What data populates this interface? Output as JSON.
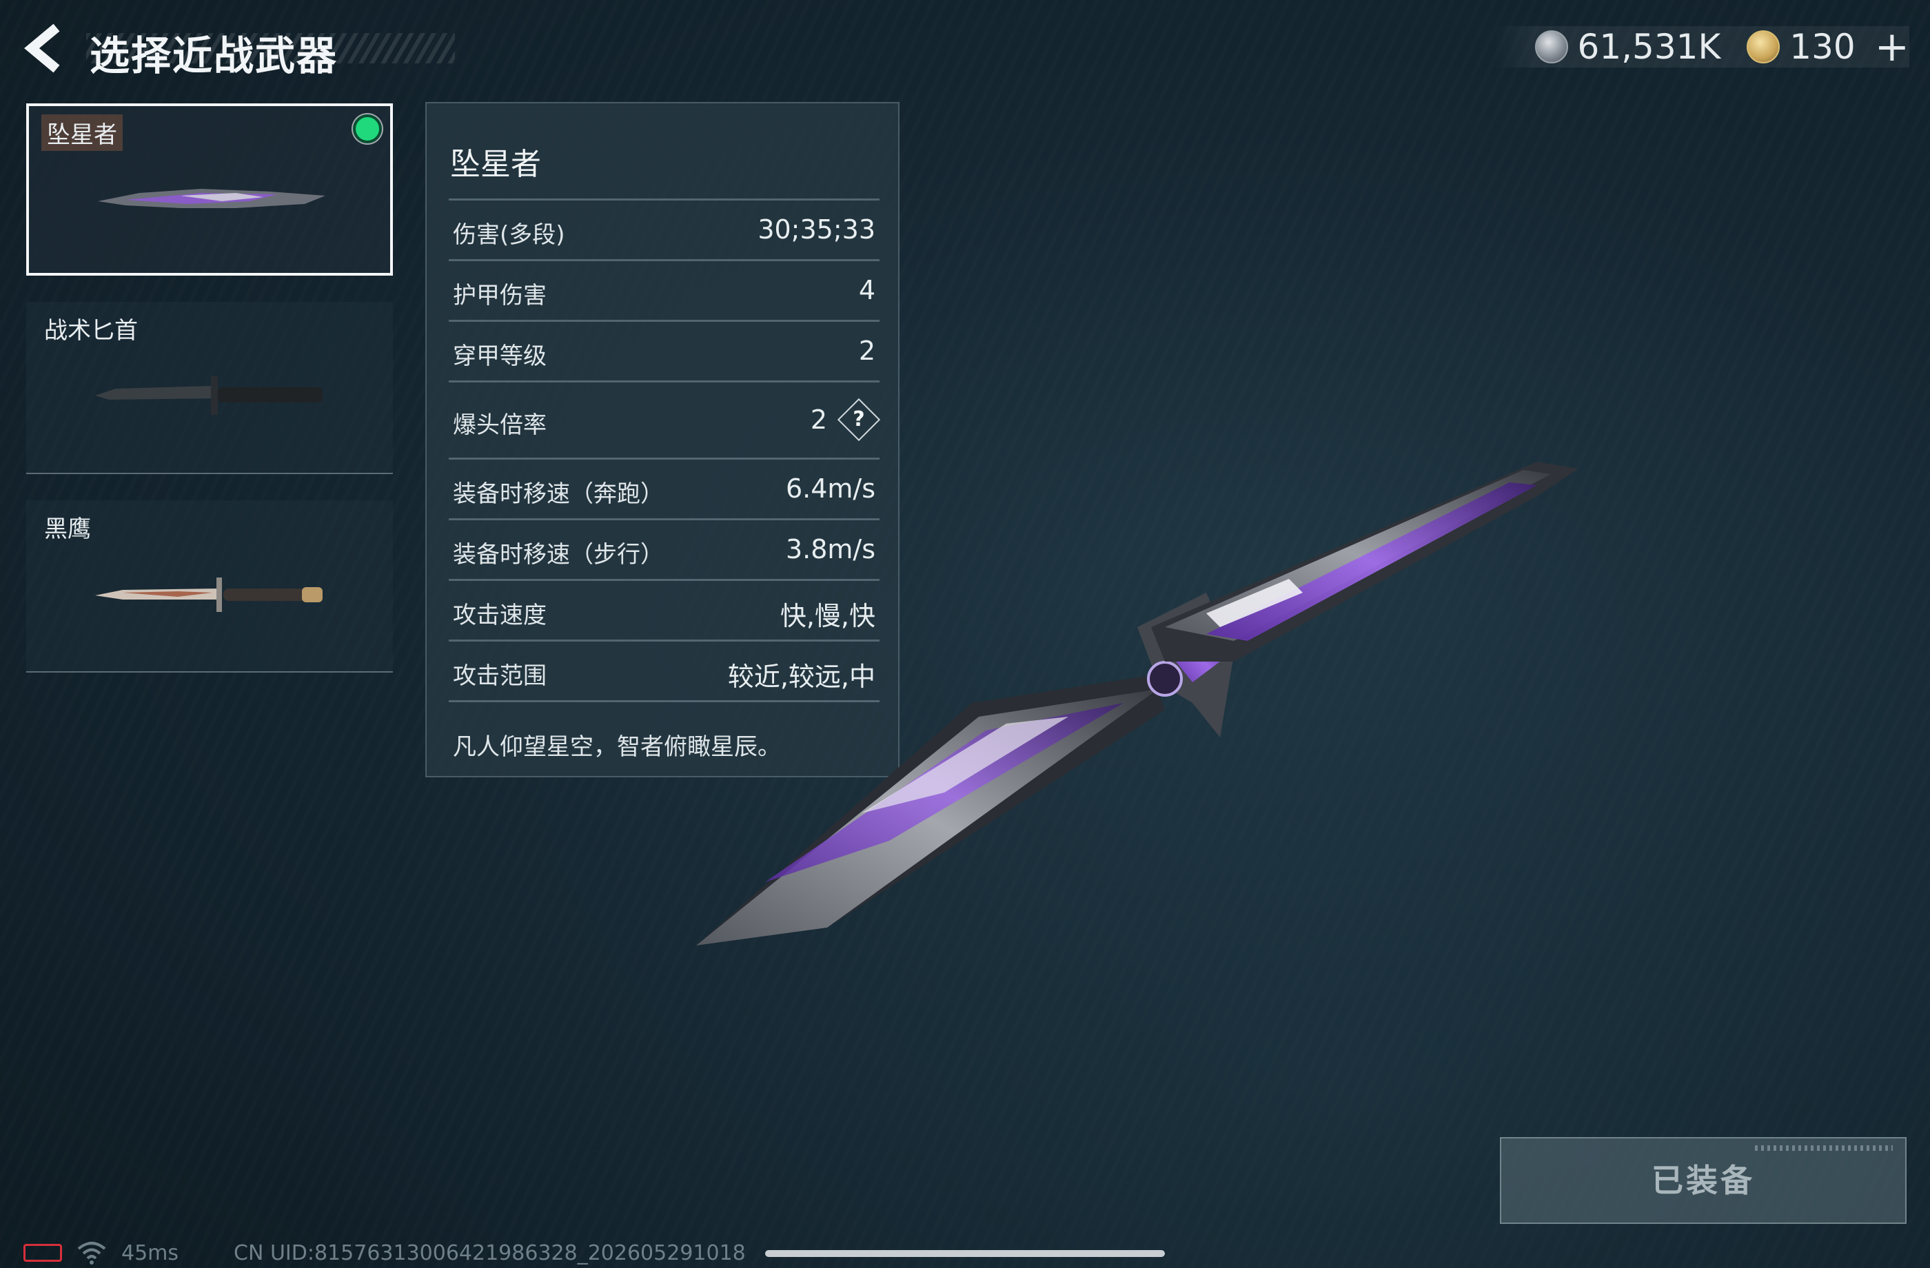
{
  "header": {
    "title": "选择近战武器",
    "currencies": [
      {
        "icon": "silver-coin-icon",
        "value": "61,531K"
      },
      {
        "icon": "gold-token-icon",
        "value": "130"
      }
    ],
    "plus_label": "+"
  },
  "weapons": [
    {
      "name": "坠星者",
      "selected": true,
      "equipped": true
    },
    {
      "name": "战术匕首",
      "selected": false,
      "equipped": false
    },
    {
      "name": "黑鹰",
      "selected": false,
      "equipped": false
    }
  ],
  "details": {
    "title": "坠星者",
    "stats": [
      {
        "label": "伤害(多段)",
        "value": "30;35;33"
      },
      {
        "label": "护甲伤害",
        "value": "4"
      },
      {
        "label": "穿甲等级",
        "value": "2"
      },
      {
        "label": "爆头倍率",
        "value": "2",
        "help": "?"
      },
      {
        "label": "装备时移速（奔跑）",
        "value": "6.4m/s"
      },
      {
        "label": "装备时移速（步行）",
        "value": "3.8m/s"
      },
      {
        "label": "攻击速度",
        "value": "快,慢,快"
      },
      {
        "label": "攻击范围",
        "value": "较近,较远,中"
      }
    ],
    "flavor": "凡人仰望星空，智者俯瞰星辰。"
  },
  "equip_button": {
    "label": "已装备"
  },
  "status": {
    "ping": "45ms",
    "uid": "CN UID:815763130064219863​28_202605291018"
  },
  "colors": {
    "accent_equipped": "#1fd97c",
    "blade_purple": "#8b52d8",
    "battery_low": "#d6303a"
  }
}
